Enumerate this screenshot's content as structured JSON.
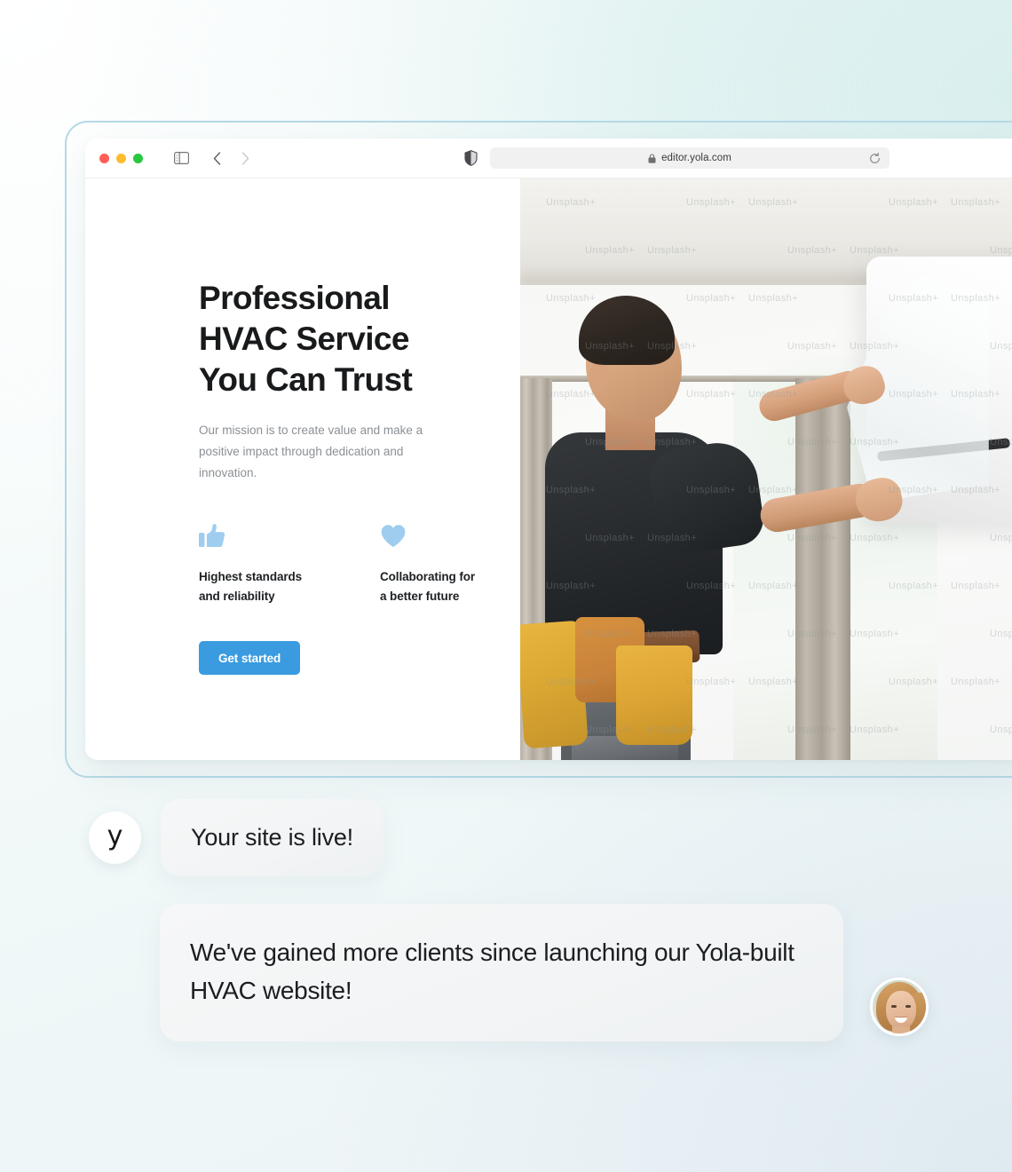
{
  "browser": {
    "traffic_lights": [
      "close",
      "minimize",
      "zoom"
    ],
    "sidebar_toggle_icon": "sidebar-icon",
    "back_label": "‹",
    "forward_label": "›",
    "shield_icon": "shield-icon",
    "lock_icon": "lock-icon",
    "url": "editor.yola.com",
    "reload_icon": "reload-icon"
  },
  "hero": {
    "title": "Professional\nHVAC Service\nYou Can Trust",
    "subtitle": "Our mission is to create value and make a positive impact through dedication and innovation.",
    "features": [
      {
        "icon": "thumbs-up-icon",
        "label": "Highest standards\nand reliability"
      },
      {
        "icon": "heart-icon",
        "label": "Collaborating for\na better future"
      }
    ],
    "cta_label": "Get started",
    "image_watermark": "Unsplash+",
    "image_alt": "HVAC technician installing an air conditioning unit"
  },
  "chat": {
    "brand_initial": "y",
    "messages": [
      {
        "text": "Your site is live!",
        "sender": "yola"
      },
      {
        "text": "We've gained more clients since launching our Yola-built HVAC website!",
        "sender": "customer"
      }
    ]
  },
  "colors": {
    "accent": "#3b9be0",
    "icon_blue": "#9ecdef",
    "frame_border": "#b6d9e6",
    "heading": "#181a1c",
    "body_text": "#8b9095"
  }
}
